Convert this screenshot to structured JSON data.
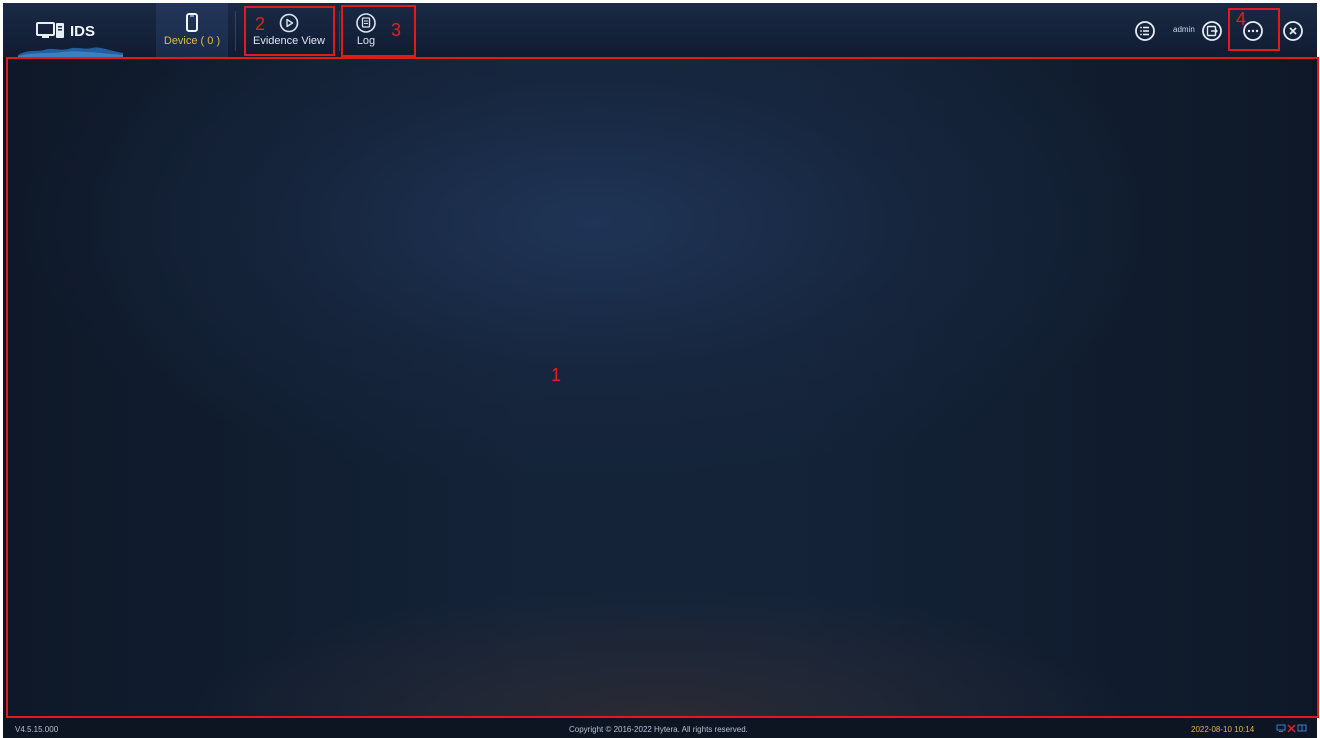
{
  "app": {
    "name": "IDS"
  },
  "nav": {
    "tabs": [
      {
        "label": "Device ( 0 )",
        "icon": "phone-icon",
        "active": true
      },
      {
        "label": "Evidence View",
        "icon": "play-circle-icon",
        "active": false
      },
      {
        "label": "Log",
        "icon": "log-file-icon",
        "active": false
      }
    ]
  },
  "header_right": {
    "menu_icon": "list-icon",
    "user": "admin",
    "logout_icon": "logout-icon",
    "more_icon": "more-icon",
    "close_icon": "close-icon"
  },
  "annotations": {
    "main_area": "1",
    "evidence_view": "2",
    "log": "3",
    "more": "4"
  },
  "status": {
    "version": "V4.5.15.000",
    "copyright": "Copyright © 2016-2022 Hytera. All rights reserved.",
    "datetime": "2022-08-10 10:14"
  },
  "colors": {
    "accent": "#e7b549",
    "annotation": "#e01b1b",
    "background": "#0d1522",
    "topbar": "#14213a"
  }
}
